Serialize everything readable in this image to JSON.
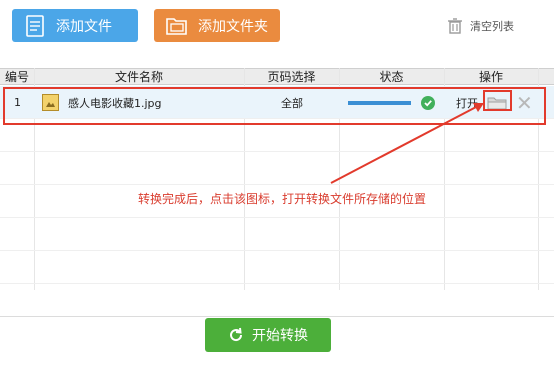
{
  "toolbar": {
    "add_file_label": "添加文件",
    "add_folder_label": "添加文件夹",
    "clear_list_label": "清空列表"
  },
  "table": {
    "headers": [
      "编号",
      "文件名称",
      "页码选择",
      "状态",
      "操作"
    ],
    "rows": [
      {
        "index": "1",
        "filename": "感人电影收藏1.jpg",
        "pages": "全部",
        "progress": 1.0,
        "status": "done",
        "open_label": "打开"
      }
    ]
  },
  "annotation": {
    "text": "转换完成后，点击该图标，打开转换文件所存储的位置"
  },
  "start_button_label": "开始转换",
  "colors": {
    "add_file": "#4ba6e8",
    "add_folder": "#ea8b3f",
    "start": "#4caf3a",
    "annotation": "#e23a2c"
  }
}
